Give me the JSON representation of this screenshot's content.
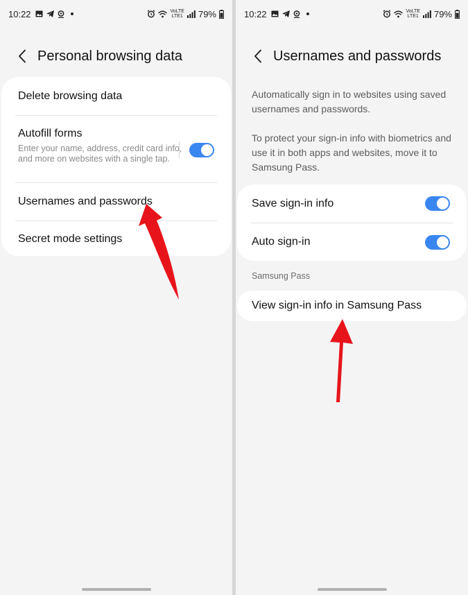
{
  "status_bar": {
    "time": "10:22",
    "network_top": "VoLTE",
    "network_bottom": "LTE1",
    "battery": "79%"
  },
  "left_screen": {
    "title": "Personal browsing data",
    "items": [
      {
        "label": "Delete browsing data"
      },
      {
        "label": "Autofill forms",
        "sublabel": "Enter your name, address, credit card info, and more on websites with a single tap.",
        "toggle_on": true
      },
      {
        "label": "Usernames and passwords"
      },
      {
        "label": "Secret mode settings"
      }
    ]
  },
  "right_screen": {
    "title": "Usernames and passwords",
    "description_1": "Automatically sign in to websites using saved usernames and passwords.",
    "description_2": "To protect your sign-in info with biometrics and use it in both apps and websites, move it to Samsung Pass.",
    "settings": [
      {
        "label": "Save sign-in info",
        "toggle_on": true
      },
      {
        "label": "Auto sign-in",
        "toggle_on": true
      }
    ],
    "section_label": "Samsung Pass",
    "pass_item": "View sign-in info in Samsung Pass"
  },
  "colors": {
    "accent": "#3a86f0",
    "annotation_arrow": "#e8141b"
  }
}
